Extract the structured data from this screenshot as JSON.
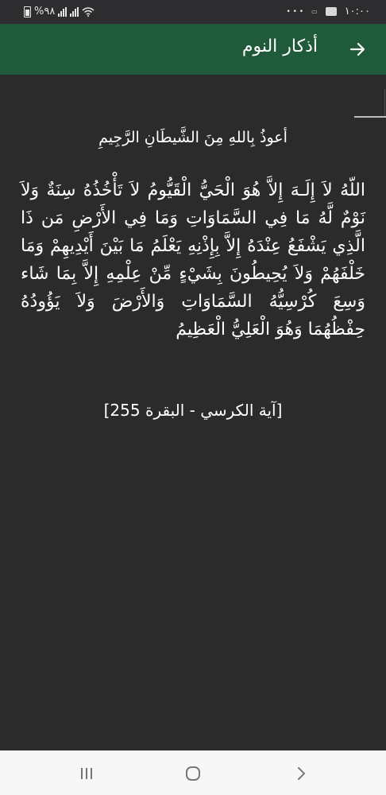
{
  "status_bar": {
    "time": "١٠:٠٠",
    "battery_percent": "%٩٨",
    "notification_dots": "• • •"
  },
  "app_bar": {
    "title": "أذكار النوم",
    "back_icon": "arrow-right-icon",
    "background_color": "#1f5a3a"
  },
  "content": {
    "isti3adha": "أعوذُ بِاللهِ مِنَ الشَّيطَانِ الرَّجِيمِ",
    "ayah": "اللّهُ لاَ إِلَـهَ إِلاَّ هُوَ الْحَيُّ الْقَيُّومُ لاَ تَأْخُذُهُ سِنَةٌ وَلاَ نَوْمٌ لَّهُ مَا فِي السَّمَاوَاتِ وَمَا فِي الأَرْضِ مَن ذَا الَّذِي يَشْفَعُ عِنْدَهُ إِلاَّ بِإِذْنِهِ يَعْلَمُ مَا بَيْنَ أَيْدِيهِمْ وَمَا خَلْفَهُمْ وَلاَ يُحِيطُونَ بِشَيْءٍ مِّنْ عِلْمِهِ إِلاَّ بِمَا شَاء وَسِعَ كُرْسِيُّهُ السَّمَاوَاتِ وَالأَرْضَ وَلاَ يَؤُودُهُ حِفْظُهُمَا وَهُوَ الْعَلِيُّ الْعَظِيمُ",
    "reference": "[آية الكرسي - البقرة 255]"
  },
  "nav_bar": {
    "recents_icon": "recents-icon",
    "home_icon": "home-icon",
    "back_icon": "back-chevron-icon"
  }
}
